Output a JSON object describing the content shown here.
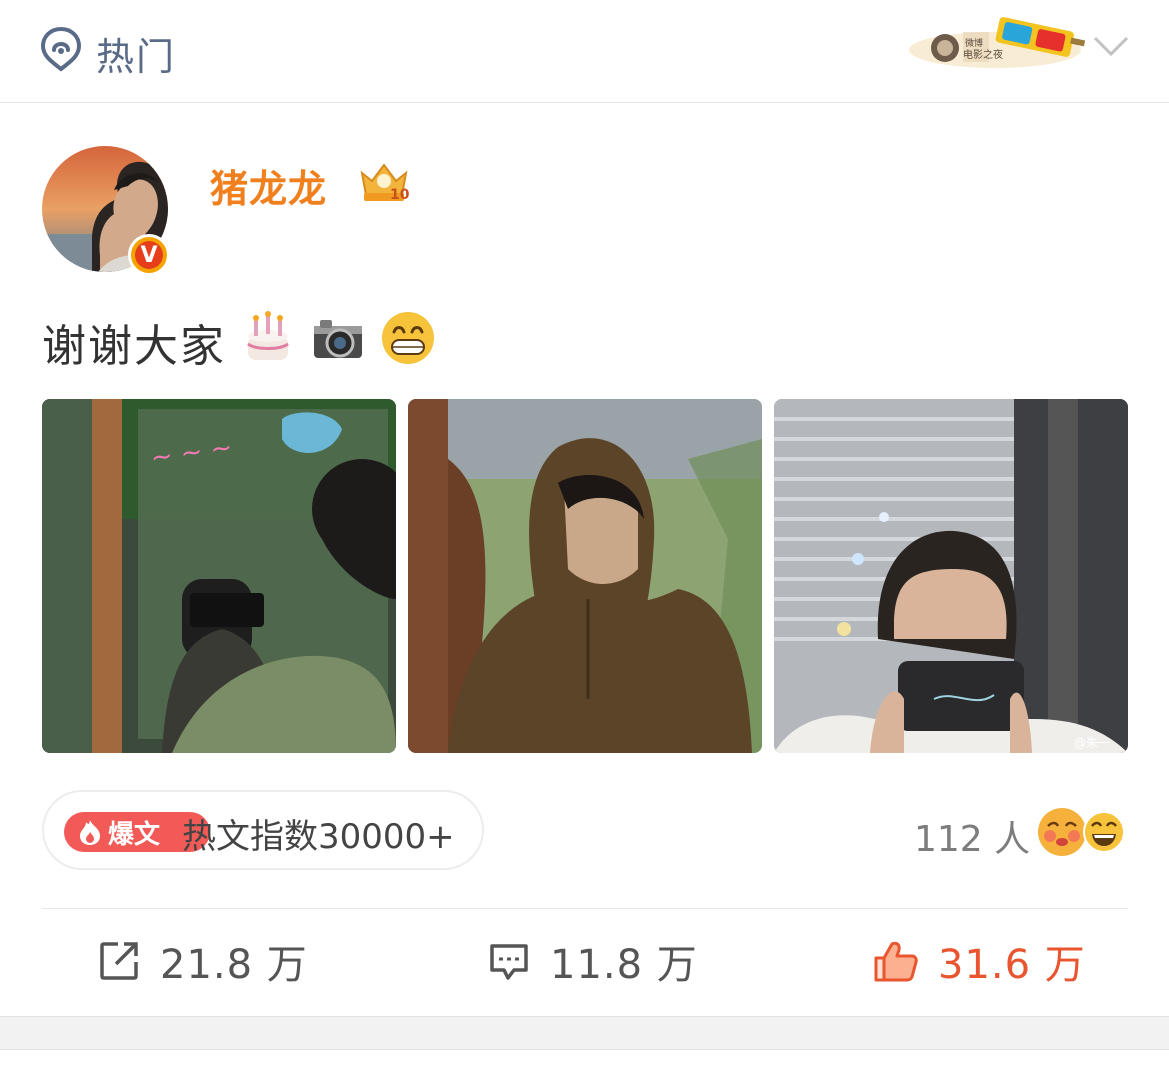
{
  "header": {
    "title": "热门",
    "banner_text": [
      "微博",
      "电影之夜"
    ]
  },
  "user": {
    "name": "猪龙龙",
    "badge_letter": "V",
    "crown_level": "10"
  },
  "post": {
    "text": "谢谢大家",
    "emojis": [
      "cake-emoji",
      "camera-emoji",
      "grin-emoji"
    ],
    "images": [
      "photo-1",
      "photo-2",
      "photo-3"
    ],
    "watermark": "@朱一"
  },
  "hot_badge": {
    "tag": "爆文",
    "label": "热文指数30000+"
  },
  "reactions": {
    "people": "112 人"
  },
  "actions": {
    "repost": "21.8 万",
    "comment": "11.8 万",
    "like": "31.6 万"
  },
  "colors": {
    "username": "#f07f1e",
    "like": "#e8552f",
    "tag_bg": "#f25a57",
    "nav": "#5a6b88"
  }
}
